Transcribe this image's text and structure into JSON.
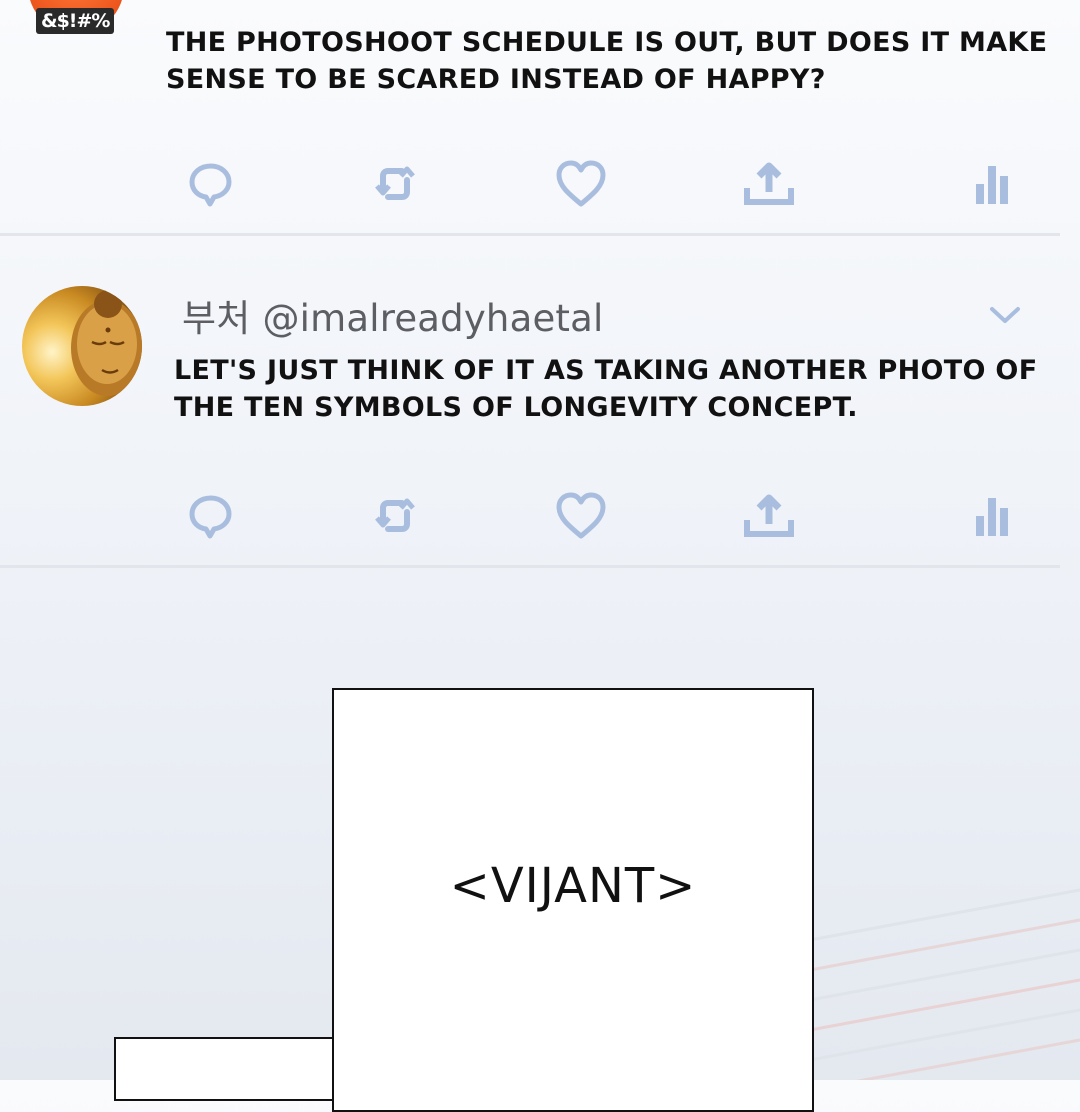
{
  "tweet1": {
    "avatar_badge": "&$!#%",
    "text": "THE PHOTOSHOOT SCHEDULE IS OUT, BUT DOES IT MAKE SENSE TO BE SCARED INSTEAD OF HAPPY?"
  },
  "tweet2": {
    "username": "부처 @imalreadyhaetal",
    "text": "LET'S JUST THINK OF IT AS TAKING ANOTHER PHOTO OF THE TEN SYMBOLS OF LONGEVITY CONCEPT."
  },
  "actions": [
    "reply-icon",
    "retweet-icon",
    "like-icon",
    "share-icon",
    "analytics-icon"
  ],
  "colors": {
    "icon": "#a9bedf",
    "text": "#111111",
    "username": "#5c5e63",
    "avatar_top": "#f05a20",
    "avatar_bottom": "#c98a22"
  },
  "panel": {
    "caption": "<VIJANT>"
  }
}
